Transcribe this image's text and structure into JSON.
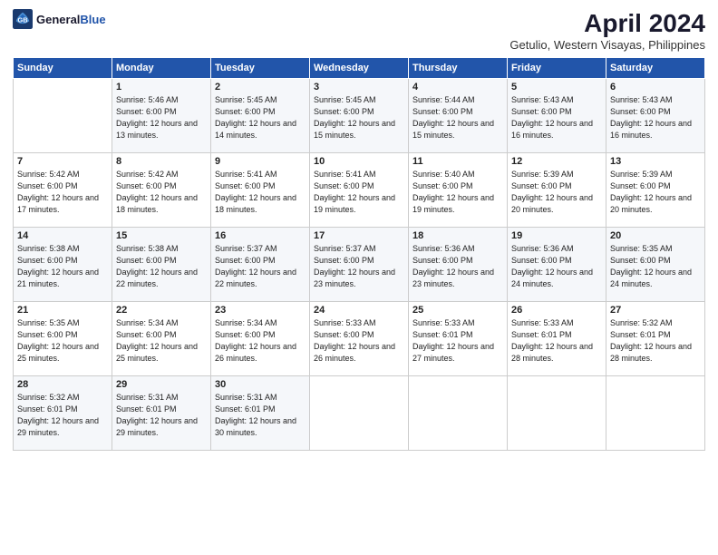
{
  "logo": {
    "line1": "General",
    "line2": "Blue"
  },
  "title": "April 2024",
  "location": "Getulio, Western Visayas, Philippines",
  "weekdays": [
    "Sunday",
    "Monday",
    "Tuesday",
    "Wednesday",
    "Thursday",
    "Friday",
    "Saturday"
  ],
  "weeks": [
    [
      {
        "day": null,
        "sunrise": null,
        "sunset": null,
        "daylight": null
      },
      {
        "day": "1",
        "sunrise": "5:46 AM",
        "sunset": "6:00 PM",
        "daylight": "12 hours and 13 minutes."
      },
      {
        "day": "2",
        "sunrise": "5:45 AM",
        "sunset": "6:00 PM",
        "daylight": "12 hours and 14 minutes."
      },
      {
        "day": "3",
        "sunrise": "5:45 AM",
        "sunset": "6:00 PM",
        "daylight": "12 hours and 15 minutes."
      },
      {
        "day": "4",
        "sunrise": "5:44 AM",
        "sunset": "6:00 PM",
        "daylight": "12 hours and 15 minutes."
      },
      {
        "day": "5",
        "sunrise": "5:43 AM",
        "sunset": "6:00 PM",
        "daylight": "12 hours and 16 minutes."
      },
      {
        "day": "6",
        "sunrise": "5:43 AM",
        "sunset": "6:00 PM",
        "daylight": "12 hours and 16 minutes."
      }
    ],
    [
      {
        "day": "7",
        "sunrise": "5:42 AM",
        "sunset": "6:00 PM",
        "daylight": "12 hours and 17 minutes."
      },
      {
        "day": "8",
        "sunrise": "5:42 AM",
        "sunset": "6:00 PM",
        "daylight": "12 hours and 18 minutes."
      },
      {
        "day": "9",
        "sunrise": "5:41 AM",
        "sunset": "6:00 PM",
        "daylight": "12 hours and 18 minutes."
      },
      {
        "day": "10",
        "sunrise": "5:41 AM",
        "sunset": "6:00 PM",
        "daylight": "12 hours and 19 minutes."
      },
      {
        "day": "11",
        "sunrise": "5:40 AM",
        "sunset": "6:00 PM",
        "daylight": "12 hours and 19 minutes."
      },
      {
        "day": "12",
        "sunrise": "5:39 AM",
        "sunset": "6:00 PM",
        "daylight": "12 hours and 20 minutes."
      },
      {
        "day": "13",
        "sunrise": "5:39 AM",
        "sunset": "6:00 PM",
        "daylight": "12 hours and 20 minutes."
      }
    ],
    [
      {
        "day": "14",
        "sunrise": "5:38 AM",
        "sunset": "6:00 PM",
        "daylight": "12 hours and 21 minutes."
      },
      {
        "day": "15",
        "sunrise": "5:38 AM",
        "sunset": "6:00 PM",
        "daylight": "12 hours and 22 minutes."
      },
      {
        "day": "16",
        "sunrise": "5:37 AM",
        "sunset": "6:00 PM",
        "daylight": "12 hours and 22 minutes."
      },
      {
        "day": "17",
        "sunrise": "5:37 AM",
        "sunset": "6:00 PM",
        "daylight": "12 hours and 23 minutes."
      },
      {
        "day": "18",
        "sunrise": "5:36 AM",
        "sunset": "6:00 PM",
        "daylight": "12 hours and 23 minutes."
      },
      {
        "day": "19",
        "sunrise": "5:36 AM",
        "sunset": "6:00 PM",
        "daylight": "12 hours and 24 minutes."
      },
      {
        "day": "20",
        "sunrise": "5:35 AM",
        "sunset": "6:00 PM",
        "daylight": "12 hours and 24 minutes."
      }
    ],
    [
      {
        "day": "21",
        "sunrise": "5:35 AM",
        "sunset": "6:00 PM",
        "daylight": "12 hours and 25 minutes."
      },
      {
        "day": "22",
        "sunrise": "5:34 AM",
        "sunset": "6:00 PM",
        "daylight": "12 hours and 25 minutes."
      },
      {
        "day": "23",
        "sunrise": "5:34 AM",
        "sunset": "6:00 PM",
        "daylight": "12 hours and 26 minutes."
      },
      {
        "day": "24",
        "sunrise": "5:33 AM",
        "sunset": "6:00 PM",
        "daylight": "12 hours and 26 minutes."
      },
      {
        "day": "25",
        "sunrise": "5:33 AM",
        "sunset": "6:01 PM",
        "daylight": "12 hours and 27 minutes."
      },
      {
        "day": "26",
        "sunrise": "5:33 AM",
        "sunset": "6:01 PM",
        "daylight": "12 hours and 28 minutes."
      },
      {
        "day": "27",
        "sunrise": "5:32 AM",
        "sunset": "6:01 PM",
        "daylight": "12 hours and 28 minutes."
      }
    ],
    [
      {
        "day": "28",
        "sunrise": "5:32 AM",
        "sunset": "6:01 PM",
        "daylight": "12 hours and 29 minutes."
      },
      {
        "day": "29",
        "sunrise": "5:31 AM",
        "sunset": "6:01 PM",
        "daylight": "12 hours and 29 minutes."
      },
      {
        "day": "30",
        "sunrise": "5:31 AM",
        "sunset": "6:01 PM",
        "daylight": "12 hours and 30 minutes."
      },
      {
        "day": null,
        "sunrise": null,
        "sunset": null,
        "daylight": null
      },
      {
        "day": null,
        "sunrise": null,
        "sunset": null,
        "daylight": null
      },
      {
        "day": null,
        "sunrise": null,
        "sunset": null,
        "daylight": null
      },
      {
        "day": null,
        "sunrise": null,
        "sunset": null,
        "daylight": null
      }
    ]
  ],
  "labels": {
    "sunrise_prefix": "Sunrise: ",
    "sunset_prefix": "Sunset: ",
    "daylight_prefix": "Daylight: "
  }
}
